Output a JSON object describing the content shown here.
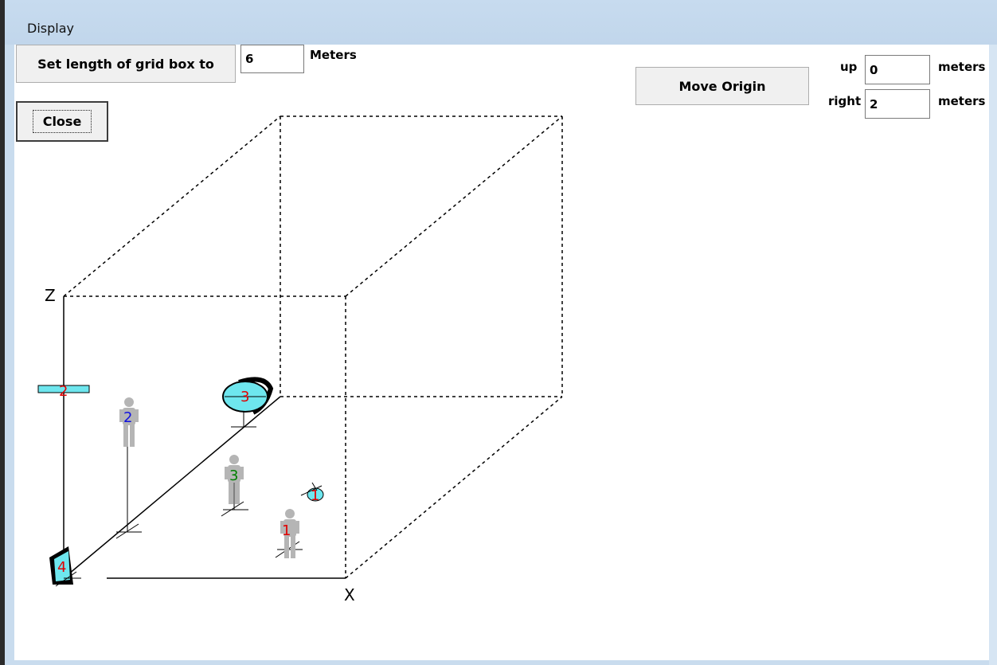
{
  "window": {
    "title": "Display"
  },
  "controls": {
    "set_grid_label": "Set length of grid box to",
    "grid_length_value": "6",
    "grid_unit": "Meters",
    "close_label": "Close",
    "move_origin_label": "Move Origin",
    "up_label": "up",
    "up_value": "0",
    "up_unit": "meters",
    "right_label": "right",
    "right_value": "2",
    "right_unit": "meters"
  },
  "scene": {
    "axis_z_label": "Z",
    "axis_x_label": "X",
    "people": [
      {
        "id": "1",
        "color": "#e00000"
      },
      {
        "id": "2",
        "color": "#1010e0"
      },
      {
        "id": "3",
        "color": "#008000"
      }
    ],
    "objects": [
      {
        "id": "1",
        "kind": "speaker",
        "color": "#e00000"
      },
      {
        "id": "2",
        "kind": "ceiling-panel",
        "color": "#e00000"
      },
      {
        "id": "3",
        "kind": "loudspeaker",
        "color": "#e00000"
      },
      {
        "id": "4",
        "kind": "wall-panel",
        "color": "#e00000"
      }
    ],
    "object_fill": "#6ee6ee",
    "person_fill": "#b5b5b5"
  }
}
